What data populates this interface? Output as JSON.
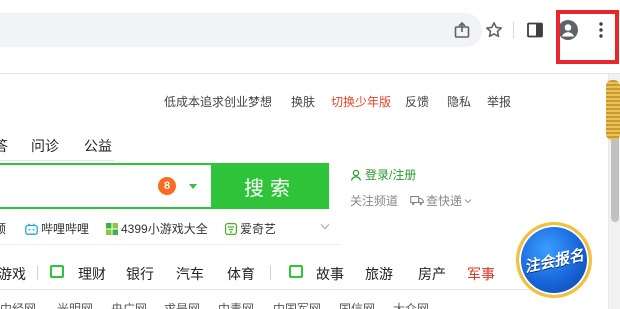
{
  "browser": {
    "buttons": [
      "share-icon",
      "star-icon",
      "side-panel-icon",
      "profile-icon",
      "more-menu-icon"
    ],
    "highlight_color": "#e8262b"
  },
  "top_links": [
    {
      "label": "低成本追求创业梦想",
      "color": "#444444"
    },
    {
      "label": "换肤",
      "color": "#444444"
    },
    {
      "label": "切换少年版",
      "color": "#e2462a"
    },
    {
      "label": "反馈",
      "color": "#444444"
    },
    {
      "label": "隐私",
      "color": "#444444"
    },
    {
      "label": "举报",
      "color": "#444444"
    }
  ],
  "nav_tabs": [
    "答",
    "问诊",
    "公益"
  ],
  "search": {
    "value": "",
    "badge": "8",
    "button_label": "搜索",
    "accent": "#2fc33a"
  },
  "user": {
    "login_label": "登录/注册",
    "follow_label": "关注频道",
    "kuaidi_label": "查快递"
  },
  "quick_sites": [
    {
      "label": "预",
      "icon": "none"
    },
    {
      "label": "哔哩哔哩",
      "icon": "bilibili-icon"
    },
    {
      "label": "4399小游戏大全",
      "icon": "game-4399-icon"
    },
    {
      "label": "爱奇艺",
      "icon": "iqiyi-icon"
    }
  ],
  "categories": [
    {
      "label": "游戏",
      "color": "#222222"
    },
    {
      "label": "理财",
      "color": "#222222"
    },
    {
      "label": "银行",
      "color": "#222222"
    },
    {
      "label": "汽车",
      "color": "#222222"
    },
    {
      "label": "体育",
      "color": "#222222"
    },
    {
      "label": "故事",
      "color": "#222222"
    },
    {
      "label": "旅游",
      "color": "#222222"
    },
    {
      "label": "房产",
      "color": "#222222"
    },
    {
      "label": "军事",
      "color": "#e0312a"
    }
  ],
  "bottom_sites": [
    "中经网",
    "光明网",
    "央广网",
    "求是网",
    "中青网",
    "中国军网",
    "国信网",
    "大众网"
  ],
  "promo": {
    "label": "注会报名"
  }
}
